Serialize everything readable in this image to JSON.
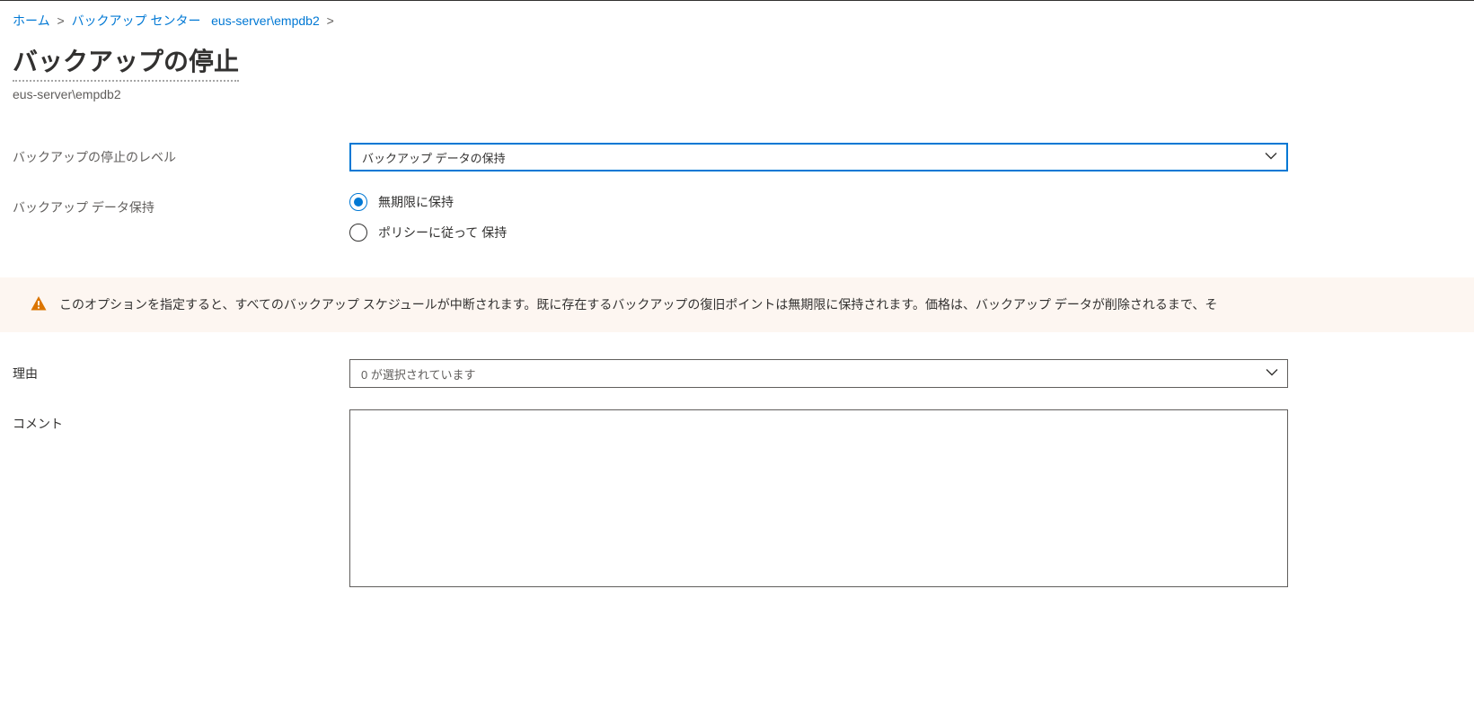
{
  "breadcrumb": {
    "home": "ホーム",
    "backup_center": "バックアップ センター",
    "item": "eus-server\\empdb2"
  },
  "header": {
    "title": "バックアップの停止",
    "subtitle": "eus-server\\empdb2"
  },
  "form": {
    "stop_level_label": "バックアップの停止のレベル",
    "stop_level_value": "バックアップ データの保持",
    "retain_label": "バックアップ データ保持",
    "retain_options": {
      "indefinitely": "無期限に保持",
      "by_policy": "ポリシーに従って 保持"
    },
    "reason_label": "理由",
    "reason_value": "0 が選択されています",
    "comment_label": "コメント",
    "comment_value": ""
  },
  "banner": {
    "text": "このオプションを指定すると、すべてのバックアップ スケジュールが中断されます。既に存在するバックアップの復旧ポイントは無期限に保持されます。価格は、バックアップ データが削除されるまで、そ"
  }
}
